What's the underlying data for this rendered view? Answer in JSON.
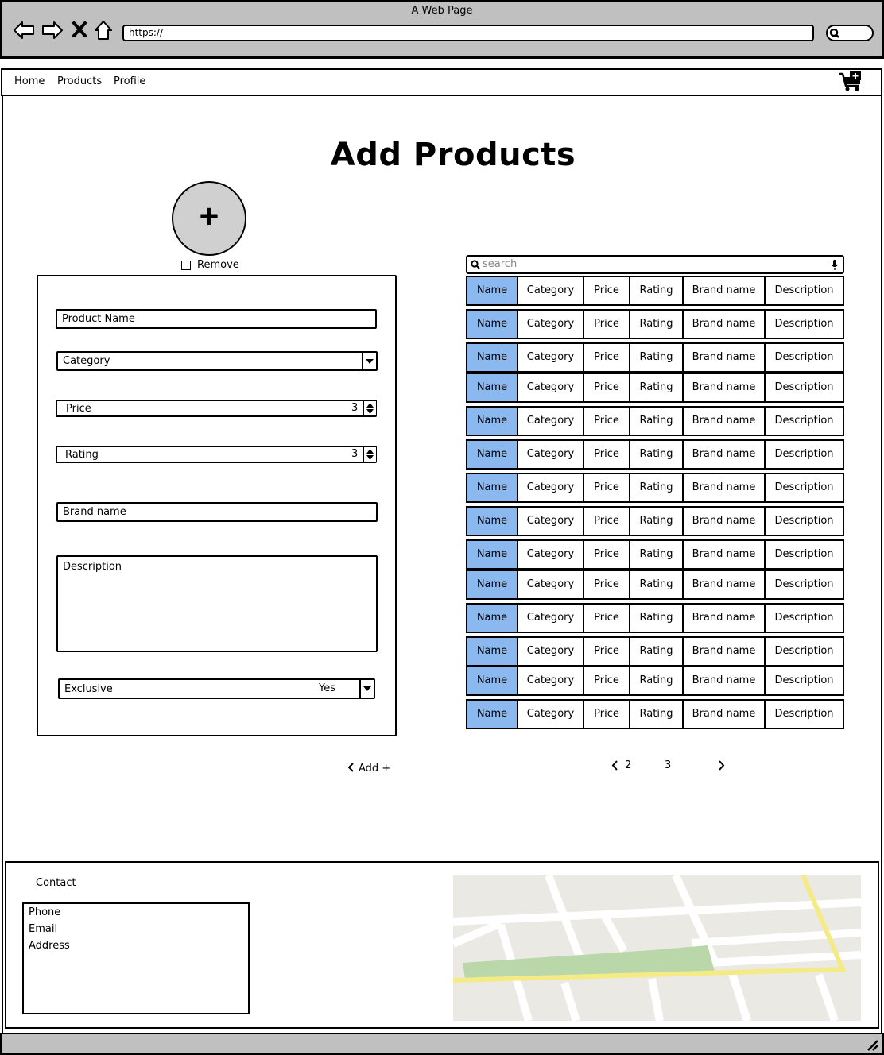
{
  "window": {
    "title": "A Web Page",
    "url": "https://"
  },
  "nav": {
    "items": [
      "Home",
      "Products",
      "Profile"
    ]
  },
  "page": {
    "title": "Add Products"
  },
  "image_upload": {
    "plus": "+",
    "remove_label": "Remove"
  },
  "form": {
    "product_name": "Product Name",
    "category": "Category",
    "price_label": "Price",
    "price_value": "3",
    "rating_label": "Rating",
    "rating_value": "3",
    "brand_name": "Brand name",
    "description": "Description",
    "exclusive_label": "Exclusive",
    "exclusive_value": "Yes",
    "add_button": "Add +"
  },
  "table": {
    "search_placeholder": "search",
    "columns": [
      "Name",
      "Category",
      "Price",
      "Rating",
      "Brand name",
      "Description"
    ],
    "row_count": 14
  },
  "pagination": {
    "pages": [
      "2",
      "3"
    ]
  },
  "footer": {
    "contact_title": "Contact",
    "contact_lines": [
      "Phone",
      "Email",
      "Address"
    ]
  },
  "colors": {
    "chrome": "#c0c0c0",
    "name_cell": "#8cb8f0",
    "map_road": "#ffffff",
    "map_park": "#b9d7a9",
    "map_highway": "#f4ea86"
  }
}
